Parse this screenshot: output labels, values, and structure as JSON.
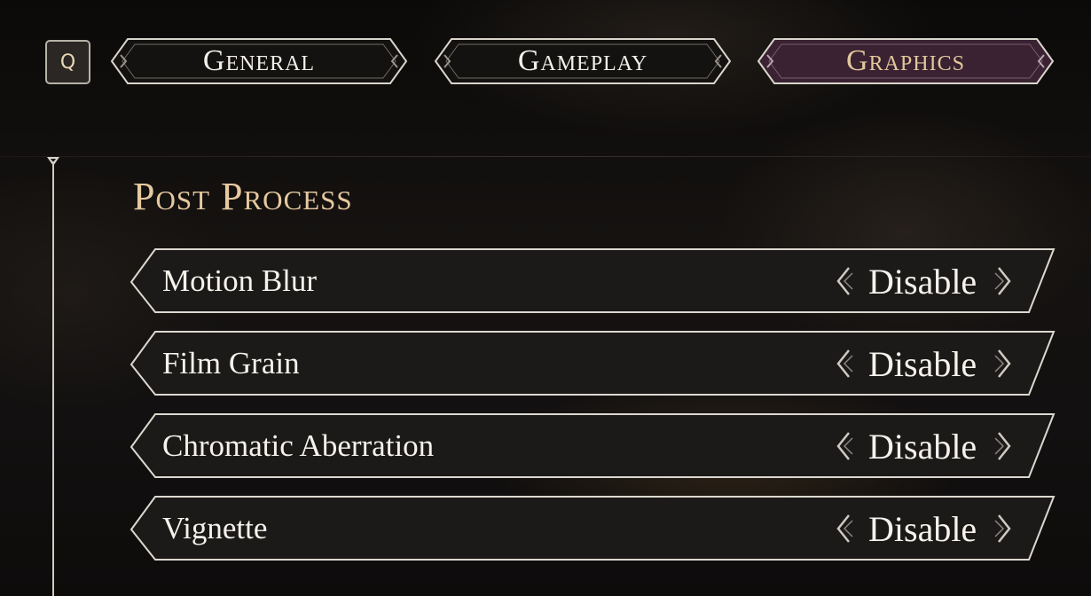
{
  "key_hint": {
    "label": "Q"
  },
  "tabs": [
    {
      "label": "General",
      "active": false
    },
    {
      "label": "Gameplay",
      "active": false
    },
    {
      "label": "Graphics",
      "active": true
    }
  ],
  "section": {
    "title": "Post Process",
    "settings": [
      {
        "label": "Motion Blur",
        "value": "Disable"
      },
      {
        "label": "Film Grain",
        "value": "Disable"
      },
      {
        "label": "Chromatic Aberration",
        "value": "Disable"
      },
      {
        "label": "Vignette",
        "value": "Disable"
      }
    ]
  },
  "colors": {
    "active_tab_bg": "#3a2232",
    "inactive_tab_bg": "#151312",
    "row_bg": "#1c1a19",
    "accent_gold": "#e6c9a0",
    "border": "#d8d4cc"
  }
}
